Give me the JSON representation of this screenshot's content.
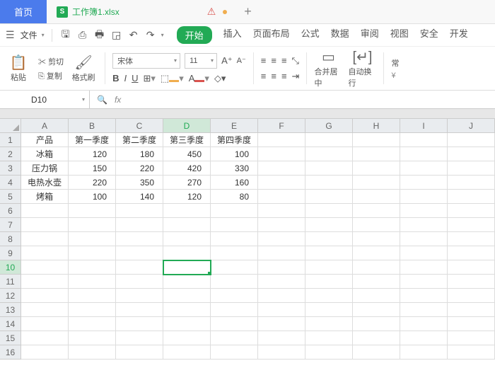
{
  "tabs": {
    "home": "首页",
    "file": "工作簿1.xlsx",
    "badge": "S",
    "warn": "⚠",
    "plus": "+"
  },
  "menubar": {
    "file": "文件",
    "items": [
      "开始",
      "插入",
      "页面布局",
      "公式",
      "数据",
      "审阅",
      "视图",
      "安全",
      "开发"
    ]
  },
  "ribbon": {
    "paste": "粘贴",
    "cut": "剪切",
    "copy": "复制",
    "format_painter": "格式刷",
    "font": "宋体",
    "size": "11",
    "merge": "合并居中",
    "wrap": "自动换行",
    "general": "常"
  },
  "cellbox": {
    "name": "D10"
  },
  "chart_data": {
    "type": "table",
    "columns": [
      "产品",
      "第一季度",
      "第二季度",
      "第三季度",
      "第四季度"
    ],
    "rows": [
      [
        "冰箱",
        120,
        180,
        450,
        100
      ],
      [
        "压力锅",
        150,
        220,
        420,
        330
      ],
      [
        "电热水壶",
        220,
        350,
        270,
        160
      ],
      [
        "烤箱",
        100,
        140,
        120,
        80
      ]
    ]
  },
  "grid": {
    "cols": [
      "A",
      "B",
      "C",
      "D",
      "E",
      "F",
      "G",
      "H",
      "I",
      "J"
    ],
    "active_col": "D",
    "active_row": 10,
    "cells": {
      "A1": "产品",
      "B1": "第一季度",
      "C1": "第二季度",
      "D1": "第三季度",
      "E1": "第四季度",
      "A2": "冰箱",
      "B2": "120",
      "C2": "180",
      "D2": "450",
      "E2": "100",
      "A3": "压力锅",
      "B3": "150",
      "C3": "220",
      "D3": "420",
      "E3": "330",
      "A4": "电热水壶",
      "B4": "220",
      "C4": "350",
      "D4": "270",
      "E4": "160",
      "A5": "烤箱",
      "B5": "100",
      "C5": "140",
      "D5": "120",
      "E5": "80"
    }
  }
}
